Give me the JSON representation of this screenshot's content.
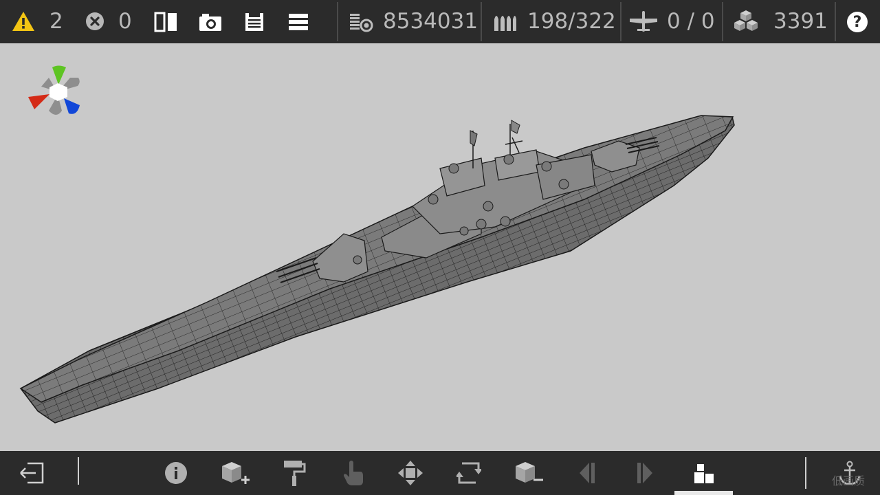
{
  "topbar": {
    "warnings": {
      "icon": "warning-icon",
      "count": "2",
      "color": "#f3c514"
    },
    "errors": {
      "icon": "error-icon",
      "count": "0"
    },
    "tools": [
      {
        "name": "mirror-icon"
      },
      {
        "name": "camera-icon"
      },
      {
        "name": "save-icon"
      },
      {
        "name": "menu-icon"
      }
    ],
    "stats": {
      "cost": {
        "icon": "cost-icon",
        "value": "8534031"
      },
      "ammo": {
        "icon": "ammo-icon",
        "value": "198/322"
      },
      "aircraft": {
        "icon": "aircraft-icon",
        "value": "0 / 0"
      },
      "blocks": {
        "icon": "blocks-icon",
        "value": "3391"
      }
    },
    "help": {
      "icon": "help-icon",
      "label": "?"
    }
  },
  "gizmo": {
    "x_color": "#d42a16",
    "y_color": "#5ec423",
    "z_color": "#1147d8"
  },
  "bottombar": {
    "tools": [
      {
        "name": "exit-icon"
      },
      {
        "name": "info-icon"
      },
      {
        "name": "add-block-icon"
      },
      {
        "name": "paint-roller-icon"
      },
      {
        "name": "select-hand-icon"
      },
      {
        "name": "move-icon"
      },
      {
        "name": "rotate-icon"
      },
      {
        "name": "remove-block-icon"
      },
      {
        "name": "previous-icon"
      },
      {
        "name": "next-icon"
      },
      {
        "name": "blocks-panel-icon"
      },
      {
        "name": "anchor-icon"
      }
    ],
    "quality_label": "低画质"
  }
}
